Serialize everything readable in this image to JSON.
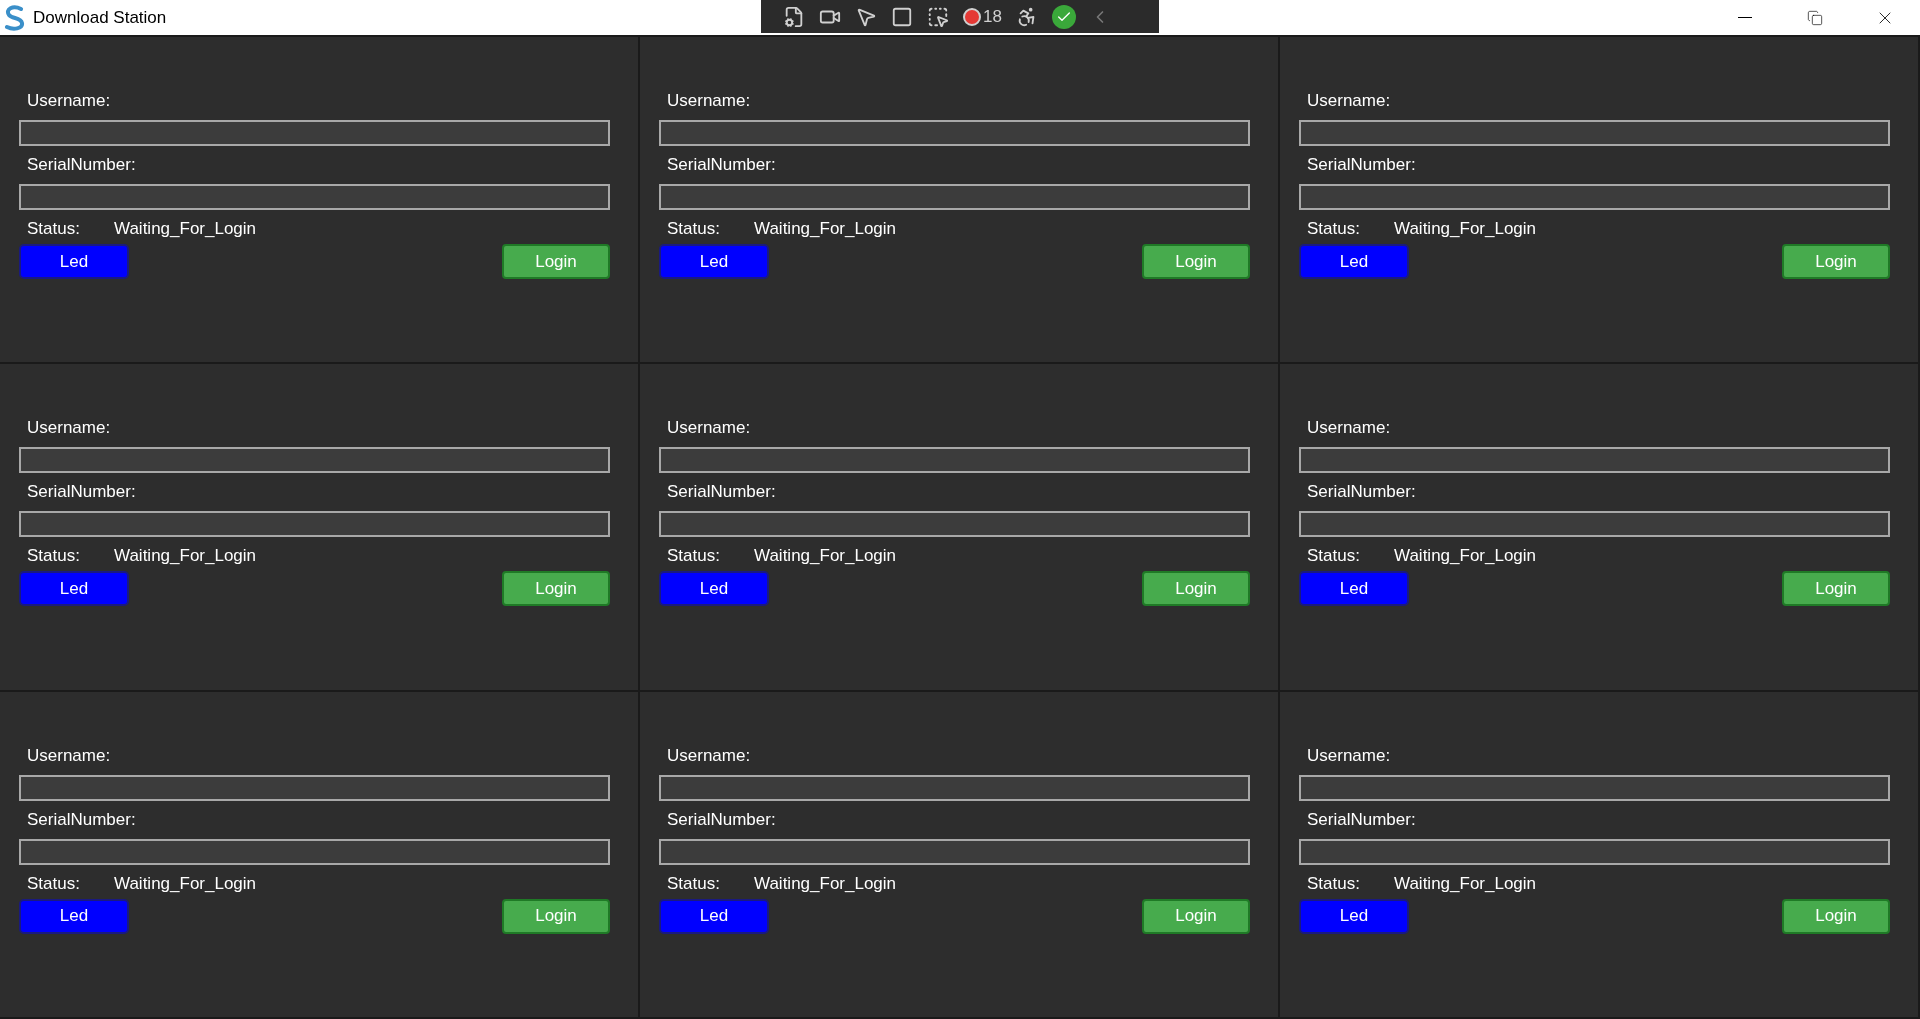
{
  "window": {
    "title": "Download Station"
  },
  "debug_toolbar": {
    "count": "18"
  },
  "panels": [
    {
      "username_label": "Username:",
      "serial_label": "SerialNumber:",
      "status_label": "Status:",
      "status_value": "Waiting_For_Login",
      "led_button": "Led",
      "login_button": "Login"
    },
    {
      "username_label": "Username:",
      "serial_label": "SerialNumber:",
      "status_label": "Status:",
      "status_value": "Waiting_For_Login",
      "led_button": "Led",
      "login_button": "Login"
    },
    {
      "username_label": "Username:",
      "serial_label": "SerialNumber:",
      "status_label": "Status:",
      "status_value": "Waiting_For_Login",
      "led_button": "Led",
      "login_button": "Login"
    },
    {
      "username_label": "Username:",
      "serial_label": "SerialNumber:",
      "status_label": "Status:",
      "status_value": "Waiting_For_Login",
      "led_button": "Led",
      "login_button": "Login"
    },
    {
      "username_label": "Username:",
      "serial_label": "SerialNumber:",
      "status_label": "Status:",
      "status_value": "Waiting_For_Login",
      "led_button": "Led",
      "login_button": "Login"
    },
    {
      "username_label": "Username:",
      "serial_label": "SerialNumber:",
      "status_label": "Status:",
      "status_value": "Waiting_For_Login",
      "led_button": "Led",
      "login_button": "Login"
    },
    {
      "username_label": "Username:",
      "serial_label": "SerialNumber:",
      "status_label": "Status:",
      "status_value": "Waiting_For_Login",
      "led_button": "Led",
      "login_button": "Login"
    },
    {
      "username_label": "Username:",
      "serial_label": "SerialNumber:",
      "status_label": "Status:",
      "status_value": "Waiting_For_Login",
      "led_button": "Led",
      "login_button": "Login"
    },
    {
      "username_label": "Username:",
      "serial_label": "SerialNumber:",
      "status_label": "Status:",
      "status_value": "Waiting_For_Login",
      "led_button": "Led",
      "login_button": "Login"
    }
  ]
}
